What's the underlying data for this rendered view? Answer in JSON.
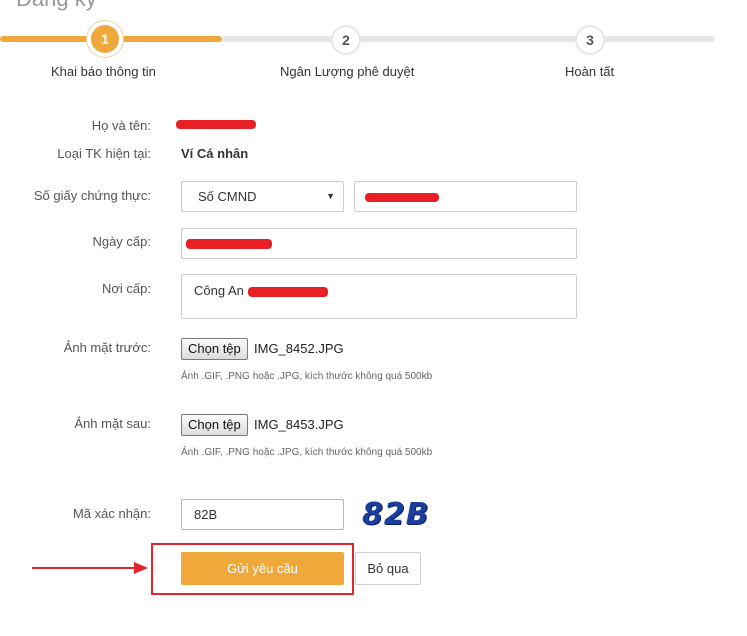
{
  "header": {
    "partial_title": "Đăng ký"
  },
  "stepper": {
    "steps": [
      {
        "number": "1",
        "label": "Khai báo thông tin"
      },
      {
        "number": "2",
        "label": "Ngân Lượng phê duyệt"
      },
      {
        "number": "3",
        "label": "Hoàn tất"
      }
    ]
  },
  "form": {
    "full_name": {
      "label": "Họ và tên:"
    },
    "account_type": {
      "label": "Loại TK hiện tại:",
      "value": "Ví Cá nhân"
    },
    "id_doc": {
      "label": "Số giấy chứng thực:",
      "select_value": "Số CMND"
    },
    "issue_date": {
      "label": "Ngày cấp:"
    },
    "issue_place": {
      "label": "Nơi cấp:",
      "value": "Công An"
    },
    "front_photo": {
      "label": "Ảnh mặt trước:",
      "button": "Chọn tệp",
      "file": "IMG_8452.JPG",
      "hint": "Ảnh .GIF, .PNG hoặc .JPG, kích thước không quá 500kb"
    },
    "back_photo": {
      "label": "Ảnh mặt sau:",
      "button": "Chọn tệp",
      "file": "IMG_8453.JPG",
      "hint": "Ảnh .GIF, .PNG hoặc .JPG, kích thước không quá 500kb"
    },
    "captcha": {
      "label": "Mã xác nhận:",
      "value": "82B",
      "image_text": "82B"
    },
    "submit_label": "Gửi yêu cầu",
    "skip_label": "Bỏ qua"
  },
  "colors": {
    "accent": "#f0a83a",
    "redaction": "#e81f25",
    "annotation": "#e0262e",
    "captcha": "#1b3e9e"
  }
}
